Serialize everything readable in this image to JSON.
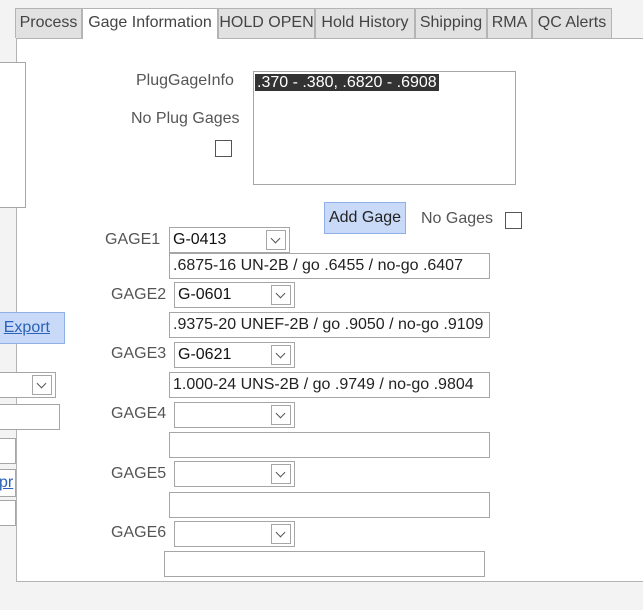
{
  "tabs": [
    {
      "label": "Process"
    },
    {
      "label": "Gage Information"
    },
    {
      "label": "HOLD OPEN"
    },
    {
      "label": "Hold History"
    },
    {
      "label": "Shipping"
    },
    {
      "label": "RMA"
    },
    {
      "label": "QC Alerts"
    }
  ],
  "active_tab": "Gage Information",
  "plug_gage": {
    "label": "PlugGageInfo",
    "value": ".370 - .380, .6820 - .6908",
    "no_plug_label": "No Plug Gages"
  },
  "add_gage_label": "Add Gage",
  "no_gages_label": "No Gages",
  "gages": [
    {
      "label": "GAGE1",
      "selected": "G-0413",
      "desc": ".6875-16 UN-2B / go .6455 / no-go .6407"
    },
    {
      "label": "GAGE2",
      "selected": "G-0601",
      "desc": ".9375-20 UNEF-2B / go .9050 / no-go .9109"
    },
    {
      "label": "GAGE3",
      "selected": "G-0621",
      "desc": "1.000-24 UNS-2B / go .9749 / no-go .9804"
    },
    {
      "label": "GAGE4",
      "selected": "",
      "desc": ""
    },
    {
      "label": "GAGE5",
      "selected": "",
      "desc": ""
    },
    {
      "label": "GAGE6",
      "selected": "",
      "desc": ""
    }
  ],
  "left_partial": {
    "export_label": "Export",
    "link_label": "pr"
  }
}
